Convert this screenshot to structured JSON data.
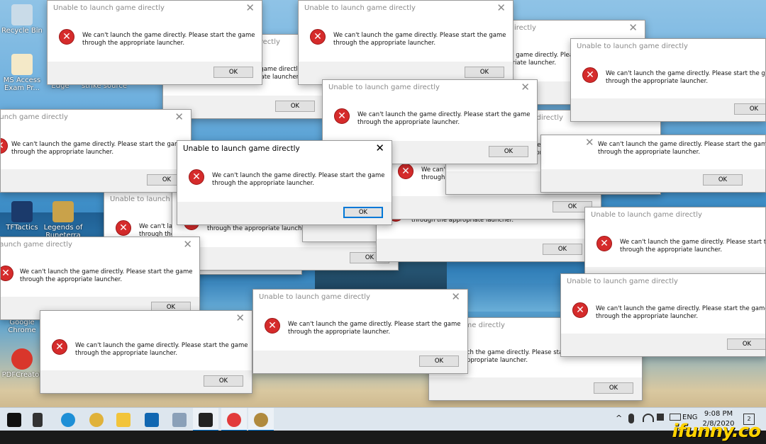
{
  "dialog": {
    "title": "Unable to launch game directly",
    "line1": "We can't launch the game directly. Please start the game",
    "line2": "through the appropriate launcher.",
    "ok_label": "OK",
    "close_glyph": "✕",
    "error_glyph": "✕"
  },
  "desktop_icons": [
    {
      "label": "Recycle Bin",
      "icon": "recycle-bin-icon",
      "color": "#c9dbe8"
    },
    {
      "label": "MS Access Exam Pr...",
      "icon": "document-icon",
      "color": "#f4e9c8"
    },
    {
      "label": "TFTactics",
      "icon": "tft-icon",
      "color": "#1b3a6b"
    },
    {
      "label": "Legends of Runeterra",
      "icon": "runeterra-icon",
      "color": "#c9a24a"
    },
    {
      "label": "Google Chrome",
      "icon": "chrome-icon",
      "color": "#e8b33a"
    },
    {
      "label": "PDFCreator",
      "icon": "pdfcreator-icon",
      "color": "#d9362b"
    }
  ],
  "desktop_partial_labels": {
    "edge": "Edge",
    "strike": "strike source"
  },
  "taskbar": {
    "apps": [
      {
        "icon": "start-icon",
        "color": "#111111"
      },
      {
        "icon": "task-view-icon",
        "color": "#333333"
      },
      {
        "icon": "edge-icon",
        "color": "#1e8fd6"
      },
      {
        "icon": "chrome-icon",
        "color": "#e0b23a"
      },
      {
        "icon": "file-explorer-icon",
        "color": "#f2c43a"
      },
      {
        "icon": "mail-icon",
        "color": "#1167b1"
      },
      {
        "icon": "photos-icon",
        "color": "#8aa0b8"
      },
      {
        "icon": "game-launcher-icon",
        "color": "#222222"
      },
      {
        "icon": "riot-client-icon",
        "color": "#e23b3b"
      },
      {
        "icon": "league-icon",
        "color": "#b08a3e"
      }
    ],
    "tray": {
      "chevron": "^",
      "language": "ENG",
      "time": "9:08 PM",
      "date": "2/8/2020",
      "notifications": "2"
    }
  },
  "watermark": "ifunny.co",
  "colors": {
    "error_red": "#d52b2b",
    "focus_blue": "#0078d7",
    "taskbar_bg": "#dde6ee"
  }
}
